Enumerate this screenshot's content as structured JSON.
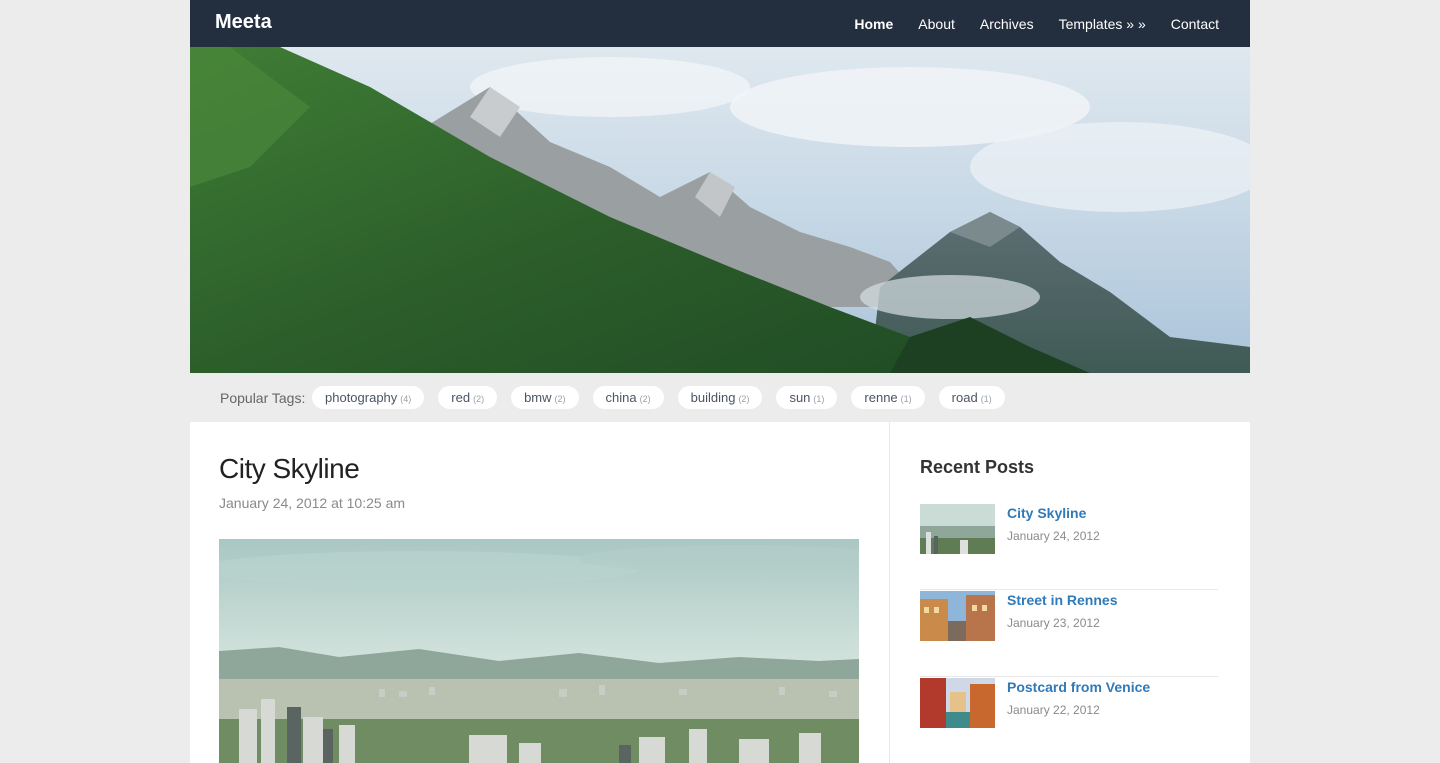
{
  "header": {
    "brand": "Meeta",
    "nav": [
      {
        "label": "Home",
        "active": true
      },
      {
        "label": "About",
        "active": false
      },
      {
        "label": "Archives",
        "active": false
      },
      {
        "label": "Templates » »",
        "active": false
      },
      {
        "label": "Contact",
        "active": false
      }
    ]
  },
  "tags": {
    "label": "Popular Tags:",
    "items": [
      {
        "name": "photography",
        "count": "(4)"
      },
      {
        "name": "red",
        "count": "(2)"
      },
      {
        "name": "bmw",
        "count": "(2)"
      },
      {
        "name": "china",
        "count": "(2)"
      },
      {
        "name": "building",
        "count": "(2)"
      },
      {
        "name": "sun",
        "count": "(1)"
      },
      {
        "name": "renne",
        "count": "(1)"
      },
      {
        "name": "road",
        "count": "(1)"
      }
    ]
  },
  "post": {
    "title": "City Skyline",
    "date": "January 24, 2012 at 10:25 am"
  },
  "sidebar": {
    "title": "Recent Posts",
    "posts": [
      {
        "title": "City Skyline",
        "date": "January 24, 2012"
      },
      {
        "title": "Street in Rennes",
        "date": "January 23, 2012"
      },
      {
        "title": "Postcard from Venice",
        "date": "January 22, 2012"
      }
    ]
  },
  "colors": {
    "topbar": "#232f3e",
    "link": "#2f7ab8",
    "background": "#ececec"
  }
}
